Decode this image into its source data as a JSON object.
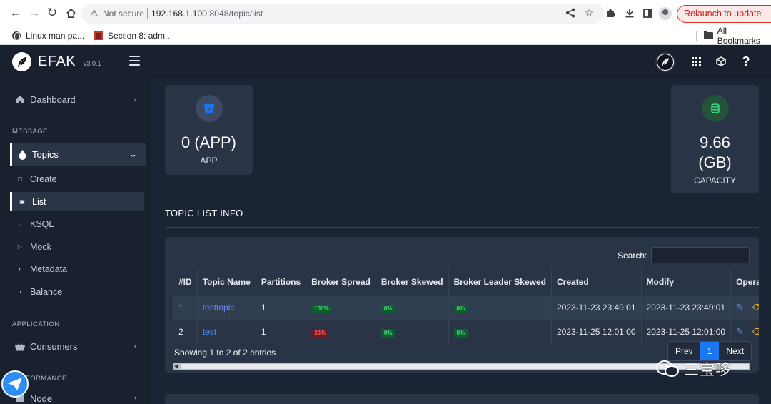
{
  "browser": {
    "security_text": "Not secure",
    "url_host": "192.168.1.100",
    "url_rest": ":8048/topic/list",
    "relaunch_label": "Relaunch to update",
    "bookmarks": [
      {
        "label": "Linux man pa..."
      },
      {
        "label": "Section 8: adm..."
      }
    ],
    "all_bookmarks_label": "All Bookmarks"
  },
  "brand": {
    "name": "EFAK",
    "version": "v3.0.1"
  },
  "sidebar": {
    "dashboard": "Dashboard",
    "section_message": "MESSAGE",
    "topics": "Topics",
    "sub_items": [
      {
        "label": "Create",
        "icon": "square-icon"
      },
      {
        "label": "List",
        "icon": "lock-icon"
      },
      {
        "label": "KSQL",
        "icon": "code-icon"
      },
      {
        "label": "Mock",
        "icon": "play-icon"
      },
      {
        "label": "Metadata",
        "icon": "circle-icon"
      },
      {
        "label": "Balance",
        "icon": "balance-icon"
      }
    ],
    "section_application": "APPLICATION",
    "consumers": "Consumers",
    "section_performance": "FORMANCE",
    "node": "Node"
  },
  "stats": {
    "app_value": "0 (APP)",
    "app_label": "APP",
    "capacity_value_line1": "9.66",
    "capacity_value_line2": "(GB)",
    "capacity_label": "CAPACITY"
  },
  "section_title": "TOPIC LIST INFO",
  "table": {
    "search_label": "Search:",
    "search_value": "",
    "headers": [
      "#ID",
      "Topic Name",
      "Partitions",
      "Broker Spread",
      "Broker Skewed",
      "Broker Leader Skewed",
      "Created",
      "Modify",
      "Opera"
    ],
    "rows": [
      {
        "id": "1",
        "name": "testtopic",
        "partitions": "1",
        "spread": "100%",
        "skewed": "0%",
        "leader_skewed": "0%",
        "created": "2023-11-23 23:49:01",
        "modify": "2023-11-23 23:49:01"
      },
      {
        "id": "2",
        "name": "test",
        "partitions": "1",
        "spread": "33%",
        "skewed": "0%",
        "leader_skewed": "0%",
        "created": "2023-11-25 12:01:00",
        "modify": "2023-11-25 12:01:00"
      }
    ],
    "showing": "Showing 1 to 2 of 2 entries",
    "pager": {
      "prev": "Prev",
      "page": "1",
      "next": "Next"
    }
  },
  "watermark": "三宝哆",
  "colors": {
    "app_icon_bg": "#3c4a63",
    "app_icon_fg": "#1877f2",
    "capacity_icon_bg": "#25533a",
    "capacity_icon_fg": "#3ddc84",
    "accent": "#1877f2"
  }
}
